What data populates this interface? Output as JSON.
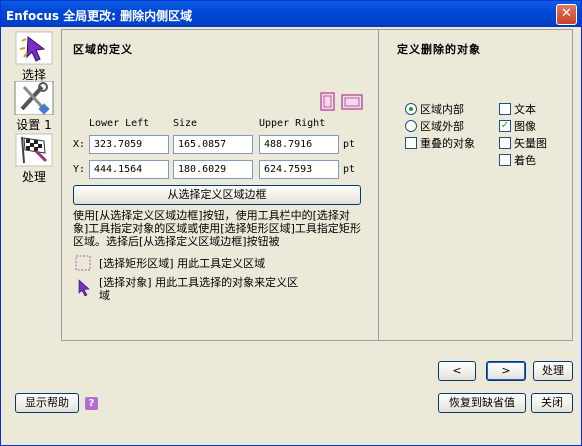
{
  "window": {
    "title": "Enfocus 全局更改: 删除内侧区域",
    "close_glyph": "✕"
  },
  "sidebar": {
    "items": [
      {
        "label": "选择",
        "icon": "selection-arrow-icon"
      },
      {
        "label": "设置 1",
        "icon": "tools-icon"
      },
      {
        "label": "处理",
        "icon": "checkered-flag-icon"
      }
    ]
  },
  "region": {
    "title": "区域的定义",
    "columns": [
      "Lower Left",
      "Size",
      "Upper Right"
    ],
    "rows": [
      {
        "label": "X:",
        "lower_left": "323.7059",
        "size": "165.0857",
        "upper_right": "488.7916",
        "unit": "pt"
      },
      {
        "label": "Y:",
        "lower_left": "444.1564",
        "size": "180.6029",
        "upper_right": "624.7593",
        "unit": "pt"
      }
    ],
    "define_button": "从选择定义区域边框",
    "description": "使用[从选择定义区域边框]按钮，使用工具栏中的[选择对象]工具指定对象的区域或使用[选择矩形区域]工具指定矩形区域。选择后[从选择定义区域边框]按钮被",
    "rect_tool_text": "[选择矩形区域] 用此工具定义区域",
    "object_tool_text": "[选择对象] 用此工具选择的对象来定义区域"
  },
  "objects": {
    "title": "定义删除的对象",
    "scope_options": [
      {
        "label": "区域内部",
        "selected": true
      },
      {
        "label": "区域外部",
        "selected": false
      }
    ],
    "overlap": {
      "label": "重叠的对象",
      "checked": false
    },
    "types": [
      {
        "label": "文本",
        "checked": false
      },
      {
        "label": "图像",
        "checked": true
      },
      {
        "label": "矢量图",
        "checked": false
      },
      {
        "label": "着色",
        "checked": false
      }
    ]
  },
  "nav": {
    "prev": "<",
    "next": ">",
    "process": "处理"
  },
  "footer": {
    "help": "显示帮助",
    "help_icon": "?",
    "restore": "恢复到缺省值",
    "close": "关闭"
  },
  "colors": {
    "titlebar": "#0046d5",
    "dialog_bg": "#ece9d8",
    "radio_dot": "#21a121"
  }
}
